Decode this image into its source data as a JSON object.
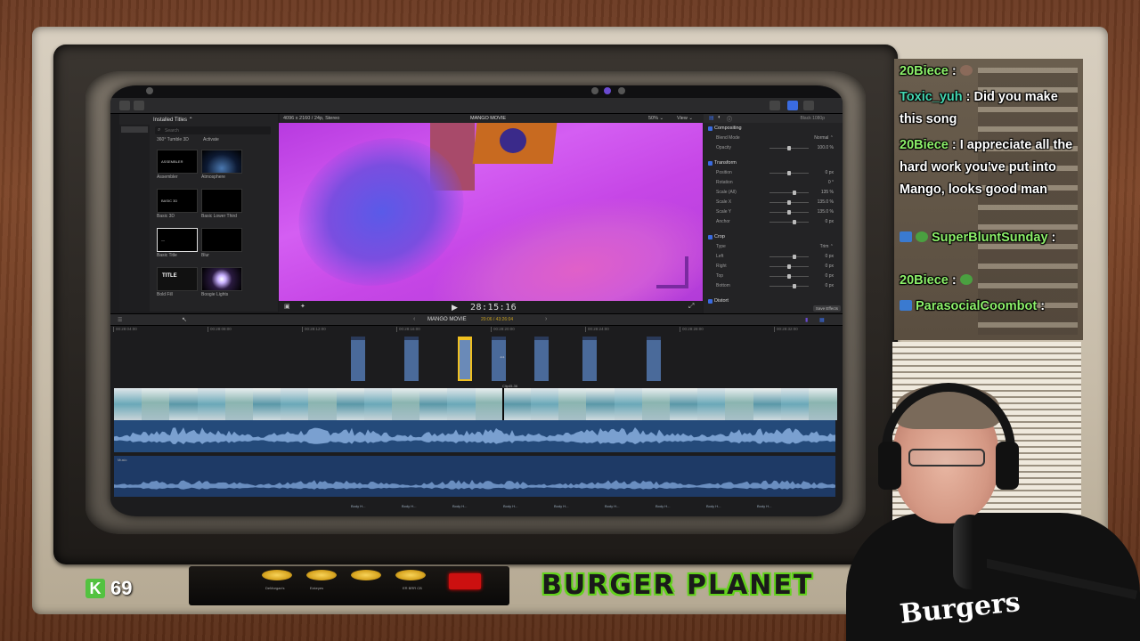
{
  "fcp": {
    "browser": {
      "title": "Installed Titles ⌃",
      "search_placeholder": "Search",
      "category_left": "360° Tumble 3D",
      "category_right": "Activate",
      "thumbs": [
        {
          "label": "Assembler",
          "inner": "ASSEMBLER"
        },
        {
          "label": "Atmosphere",
          "inner": ""
        },
        {
          "label": "Basic 3D",
          "inner": "BASIC 3D"
        },
        {
          "label": "Basic Lower Third",
          "inner": ""
        },
        {
          "label": "Basic Title",
          "inner": "—"
        },
        {
          "label": "Blur",
          "inner": ""
        },
        {
          "label": "Bold Fill",
          "inner": "TITLE"
        },
        {
          "label": "Boogie Lights",
          "inner": ""
        }
      ]
    },
    "viewer": {
      "format": "4096 x 2160 / 24p, Stereo",
      "project": "MANGO MOVIE",
      "zoom": "50% ⌄",
      "view": "View ⌄",
      "timecode": "28:15:16"
    },
    "inspector": {
      "header": "Black 1080p",
      "rows": [
        {
          "label": "Compositing",
          "value": "",
          "type": "section"
        },
        {
          "label": "Blend Mode",
          "value": "Normal ⌃",
          "type": "row"
        },
        {
          "label": "Opacity",
          "value": "100.0 %",
          "type": "row"
        },
        {
          "label": "Transform",
          "value": "",
          "type": "section"
        },
        {
          "label": "Position",
          "value": "0 px",
          "type": "row"
        },
        {
          "label": "Rotation",
          "value": "0 °",
          "type": "row"
        },
        {
          "label": "Scale (All)",
          "value": "135 %",
          "type": "row"
        },
        {
          "label": "Scale X",
          "value": "135.0 %",
          "type": "row"
        },
        {
          "label": "Scale Y",
          "value": "135.0 %",
          "type": "row"
        },
        {
          "label": "Anchor",
          "value": "0 px",
          "type": "row"
        },
        {
          "label": "Crop",
          "value": "",
          "type": "section"
        },
        {
          "label": "Type",
          "value": "Trim ⌃",
          "type": "row"
        },
        {
          "label": "Left",
          "value": "0 px",
          "type": "row"
        },
        {
          "label": "Right",
          "value": "0 px",
          "type": "row"
        },
        {
          "label": "Top",
          "value": "0 px",
          "type": "row"
        },
        {
          "label": "Bottom",
          "value": "0 px",
          "type": "row"
        },
        {
          "label": "Distort",
          "value": "",
          "type": "section"
        }
      ],
      "save_effects": "Save Effects"
    },
    "timeline": {
      "project": "MANGO MOVIE",
      "duration": "20:06 / 43:26:04",
      "ruler": [
        "00:28:04:00",
        "00:28:08:00",
        "00:28:12:00",
        "00:28:16:00",
        "00:28:20:00",
        "00:28:24:00",
        "00:28:28:00",
        "00:28:32:00"
      ],
      "music_label": "Music",
      "clip_marker": "Clip45-36",
      "connected_labels": [
        "Body H...",
        "Body H...",
        "Body H...",
        "Body H...",
        "Body H...",
        "Body H...",
        "Body H...",
        "Body H...",
        "Body H..."
      ]
    }
  },
  "tv": {
    "kudos_count": "69",
    "k_icon": "K",
    "brand": "BURGER PLANET",
    "knobs": [
      "DeMorgan's",
      "Ezkeyes",
      "",
      "ER BRR CB"
    ]
  },
  "chat": [
    {
      "user": "20Biece",
      "msg": "",
      "badges": [
        "dog-emote"
      ],
      "color": "#8df06a"
    },
    {
      "user": "Toxic_yuh",
      "msg": "Did you make this song",
      "badges": [],
      "color": "#44d6b0"
    },
    {
      "user": "20Biece",
      "msg": "I appreciate all the hard work you've put into Mango, looks good man",
      "badges": [],
      "color": "#8df06a"
    },
    {
      "user": "SuperBluntSunday",
      "msg": "",
      "badges": [
        "prime-badge",
        "pepe-emote"
      ],
      "color": "#8df06a"
    },
    {
      "user": "20Biece",
      "msg": "",
      "badges": [
        "pepe-emote"
      ],
      "color": "#8df06a"
    },
    {
      "user": "ParasocialCoombot",
      "msg": "",
      "badges": [
        "prime-badge"
      ],
      "color": "#8df06a"
    }
  ],
  "webcam": {
    "shirt_text": "Burgers"
  },
  "colors": {
    "accent_green": "#62d21c",
    "chat_name_green": "#8df06a",
    "chat_name_teal": "#44d6b0",
    "selection_yellow": "#f0c020"
  }
}
